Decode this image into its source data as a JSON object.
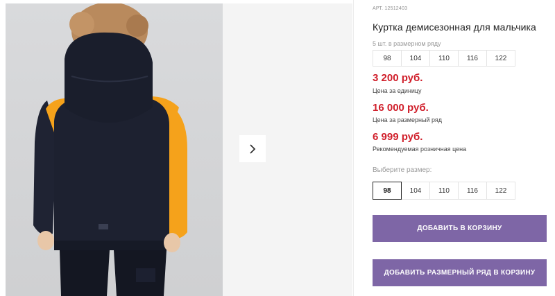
{
  "product": {
    "article": "АРТ. 12512403",
    "title": "Куртка демисезонная для мальчика"
  },
  "pack": {
    "note": "5 шт. в размерном ряду",
    "sizes": [
      "98",
      "104",
      "110",
      "116",
      "122"
    ]
  },
  "prices": {
    "unit_price": "3 200 руб.",
    "unit_label": "Цена за единицу",
    "pack_price": "16 000 руб.",
    "pack_label": "Цена за размерный ряд",
    "retail_price": "6 999 руб.",
    "retail_label": "Рекомендуемая розничная цена"
  },
  "size_select": {
    "label": "Выберите размер:",
    "sizes": [
      "98",
      "104",
      "110",
      "116",
      "122"
    ],
    "selected": "98"
  },
  "buttons": {
    "add_to_cart": "Добавить в корзину",
    "add_pack_to_cart": "Добавить размерный ряд в корзину"
  },
  "gallery": {
    "next_icon": "chevron-right-icon"
  },
  "colors": {
    "price": "#d01e2a",
    "button": "#7e66a6",
    "jacket_body": "#1d2130",
    "jacket_accent": "#f5a21b"
  }
}
